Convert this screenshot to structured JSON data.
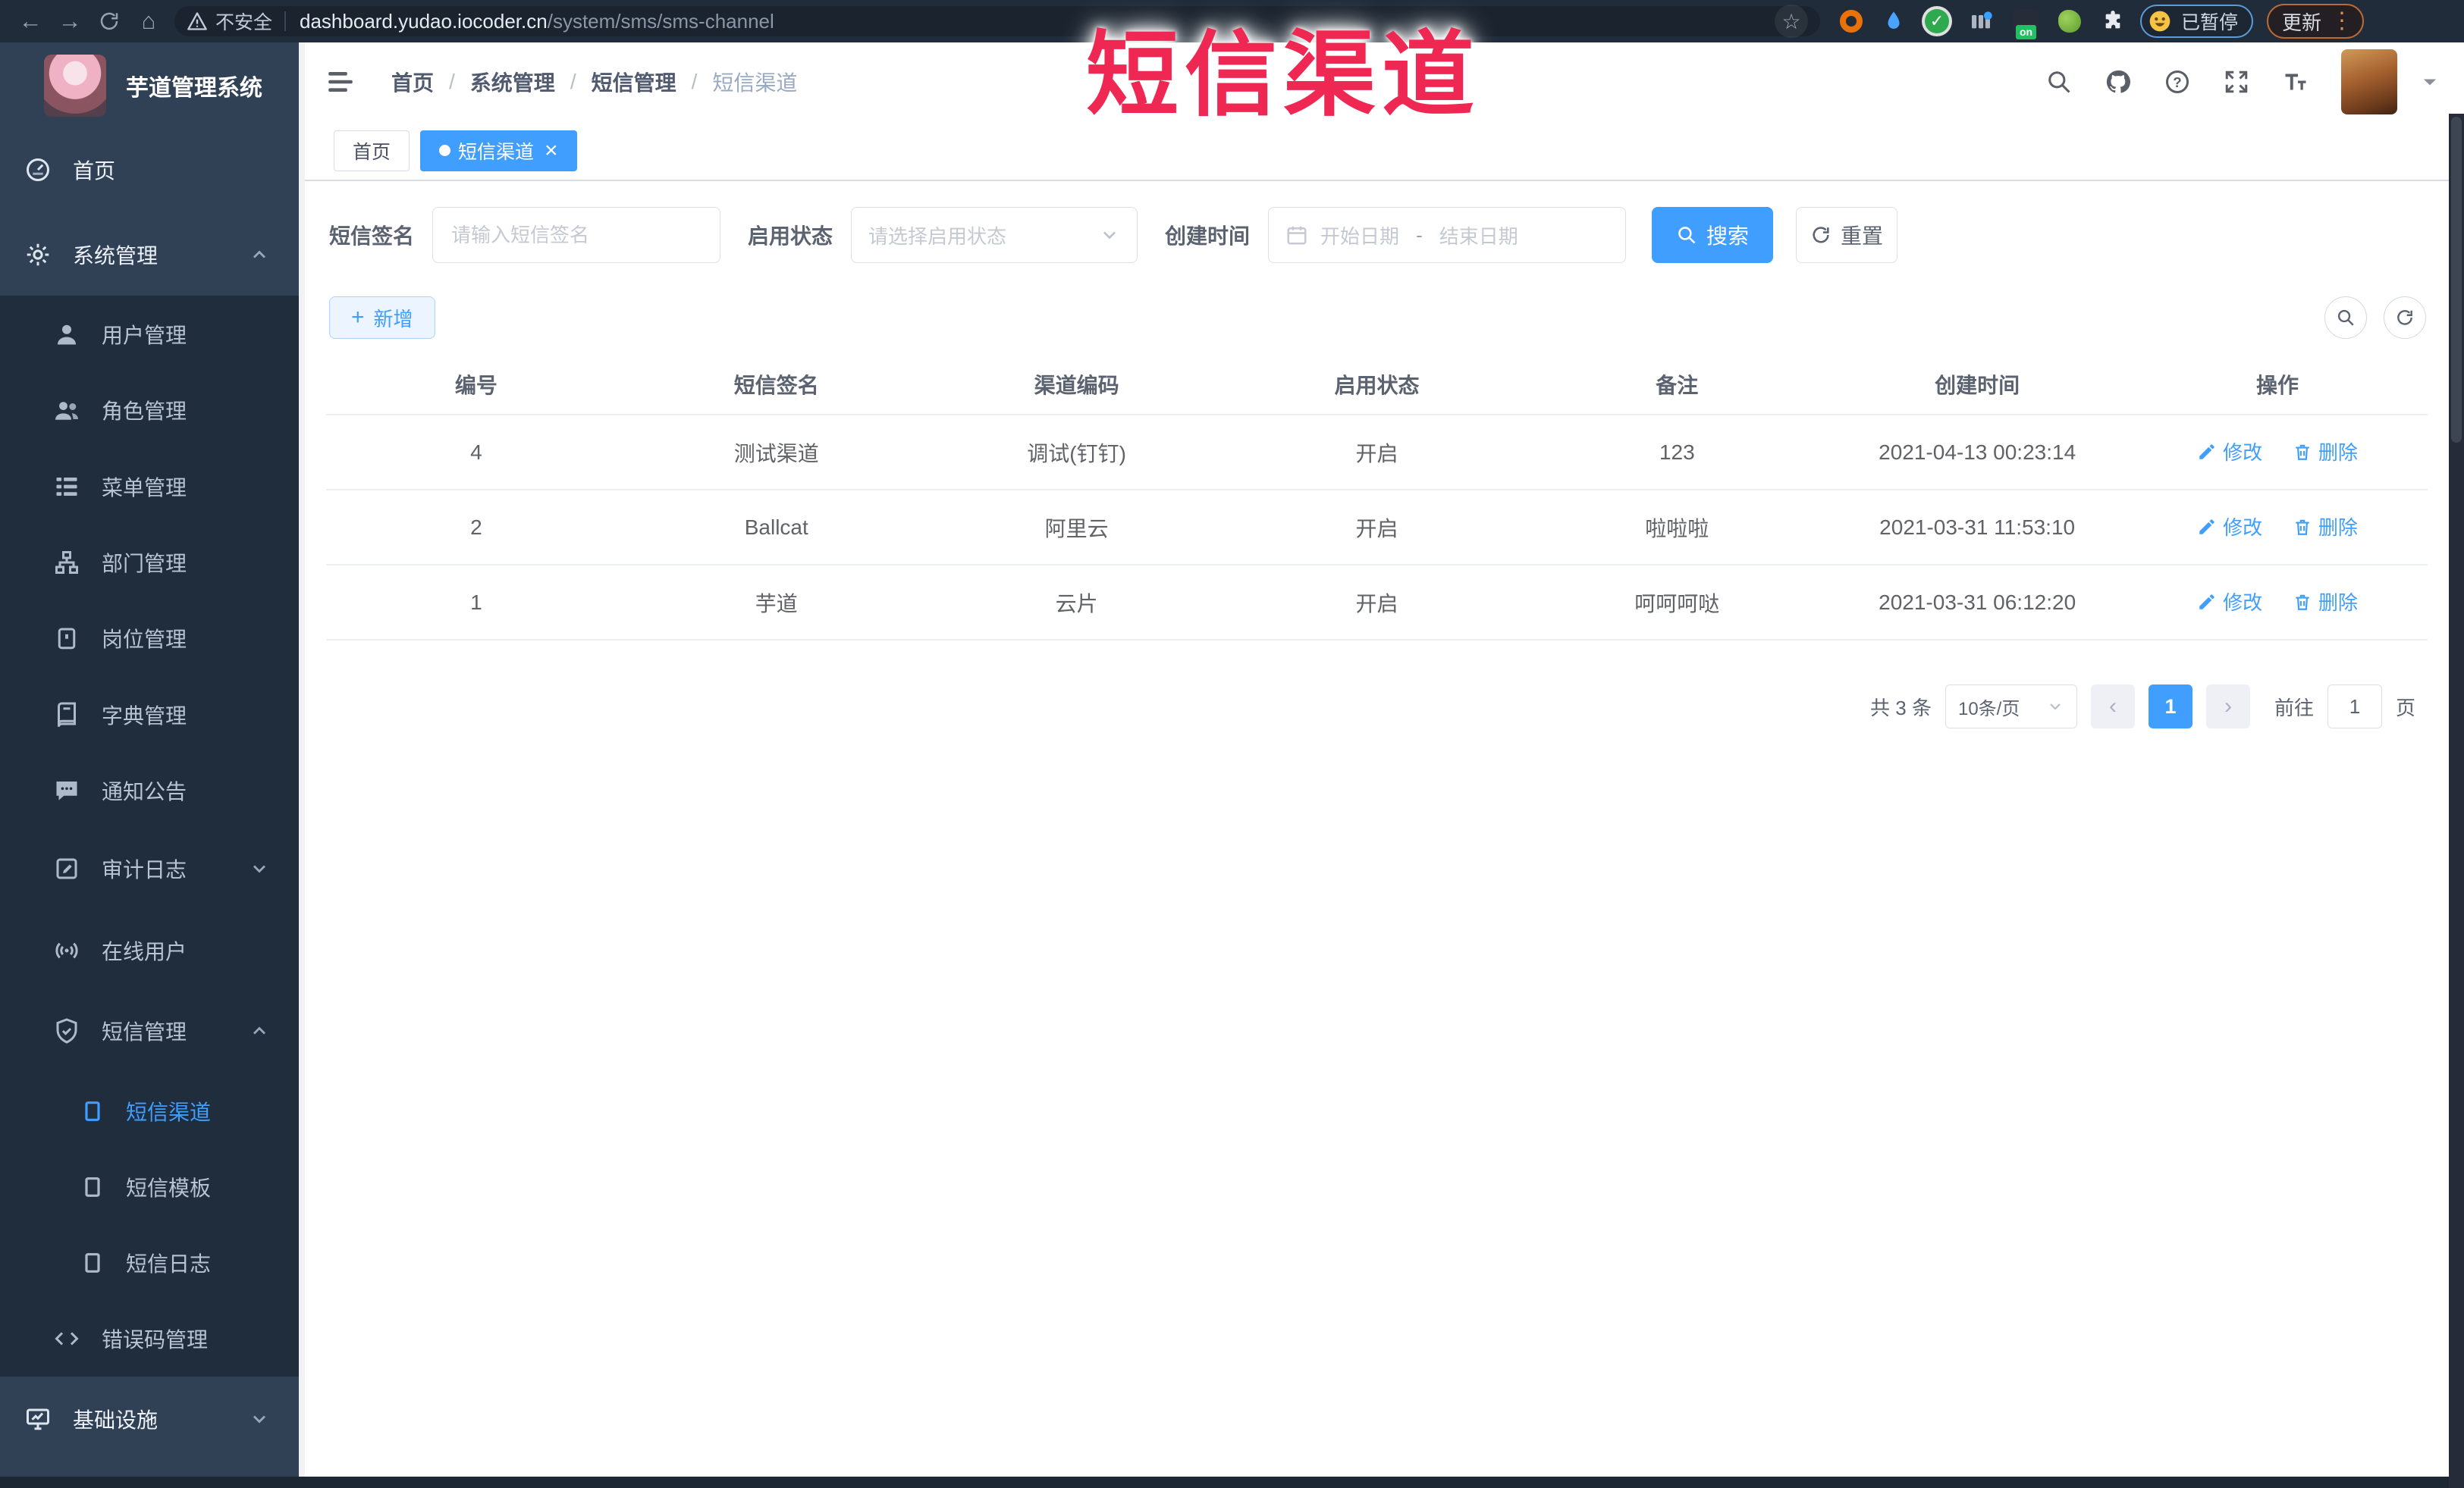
{
  "overlay": {
    "title": "短信渠道"
  },
  "browser": {
    "security": "不安全",
    "url_domain": "dashboard.yudao.iocoder.cn",
    "url_path": "/system/sms/sms-channel",
    "paused": "已暂停",
    "update": "更新",
    "ext_on_badge": "on"
  },
  "sidebar": {
    "app_title": "芋道管理系统",
    "home": "首页",
    "system": "系统管理",
    "user": "用户管理",
    "role": "角色管理",
    "menu": "菜单管理",
    "dept": "部门管理",
    "post": "岗位管理",
    "dict": "字典管理",
    "notice": "通知公告",
    "audit": "审计日志",
    "online": "在线用户",
    "sms": "短信管理",
    "sms_channel": "短信渠道",
    "sms_template": "短信模板",
    "sms_log": "短信日志",
    "errcode": "错误码管理",
    "infra": "基础设施"
  },
  "header": {
    "breadcrumb": [
      "首页",
      "系统管理",
      "短信管理",
      "短信渠道"
    ]
  },
  "tabs": {
    "home": "首页",
    "active": "短信渠道"
  },
  "filters": {
    "sign_label": "短信签名",
    "sign_placeholder": "请输入短信签名",
    "status_label": "启用状态",
    "status_placeholder": "请选择启用状态",
    "time_label": "创建时间",
    "date_start": "开始日期",
    "date_sep": "-",
    "date_end": "结束日期",
    "search": "搜索",
    "reset": "重置"
  },
  "toolbar": {
    "add": "新增"
  },
  "table": {
    "headers": [
      "编号",
      "短信签名",
      "渠道编码",
      "启用状态",
      "备注",
      "创建时间",
      "操作"
    ],
    "rows": [
      {
        "id": "4",
        "sign": "测试渠道",
        "code": "调试(钉钉)",
        "status": "开启",
        "remark": "123",
        "created": "2021-04-13 00:23:14",
        "edit": "修改",
        "del": "删除"
      },
      {
        "id": "2",
        "sign": "Ballcat",
        "code": "阿里云",
        "status": "开启",
        "remark": "啦啦啦",
        "created": "2021-03-31 11:53:10",
        "edit": "修改",
        "del": "删除"
      },
      {
        "id": "1",
        "sign": "芋道",
        "code": "云片",
        "status": "开启",
        "remark": "呵呵呵哒",
        "created": "2021-03-31 06:12:20",
        "edit": "修改",
        "del": "删除"
      }
    ]
  },
  "pagination": {
    "total": "共 3 条",
    "page_size": "10条/页",
    "page": "1",
    "goto": "前往",
    "goto_value": "1",
    "unit": "页"
  },
  "colors": {
    "accent": "#409eff",
    "sidebar_bg": "#304156",
    "submenu_bg": "#1f2d3d",
    "overlay_red": "#ef2853"
  }
}
